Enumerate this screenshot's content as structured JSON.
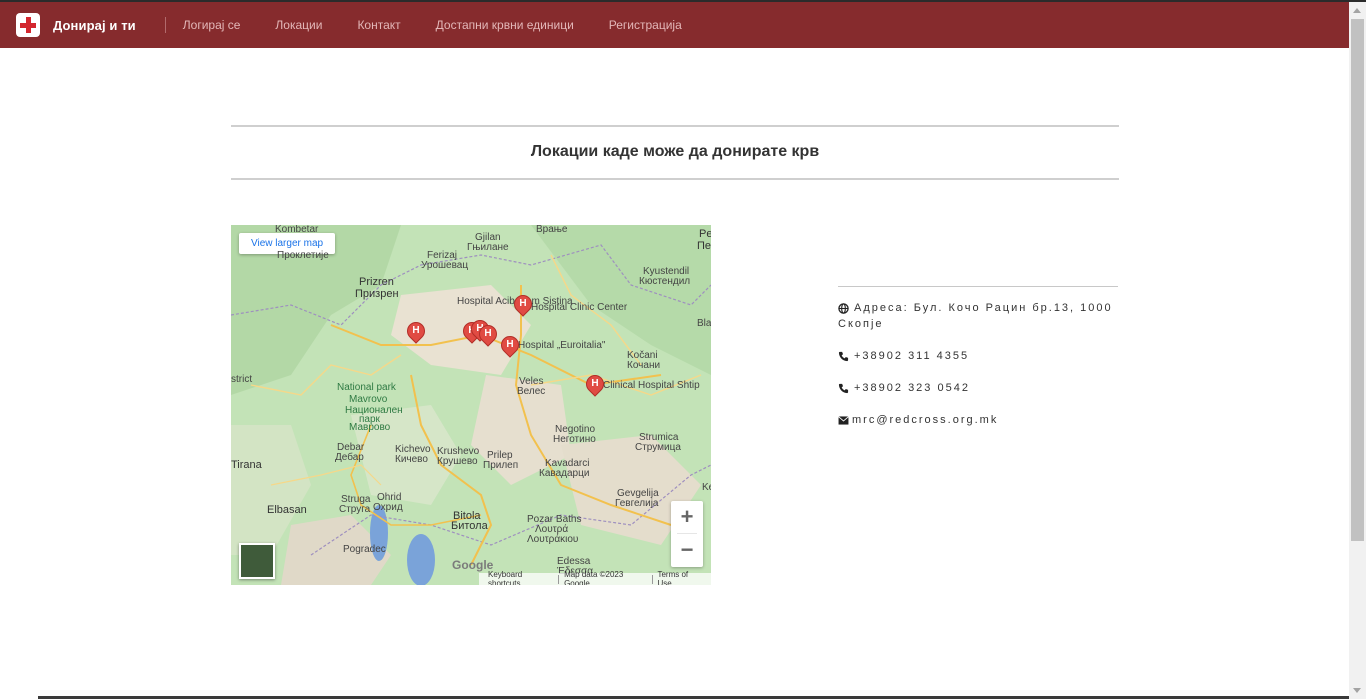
{
  "nav": {
    "brand": "Донирај и ти",
    "links": [
      "Логирај се",
      "Локации",
      "Контакт",
      "Достапни крвни единици",
      "Регистрација"
    ]
  },
  "main": {
    "title": "Локации каде може да донирате крв"
  },
  "map": {
    "view_larger": "View larger map",
    "zoom_in": "+",
    "zoom_out": "−",
    "google": "Google",
    "keyboard_shortcuts": "Keyboard shortcuts",
    "map_data": "Map data ©2023 Google",
    "terms": "Terms of Use",
    "places": {
      "kombetar": "Kombetar",
      "vranje": "Врање",
      "pe": "Pe",
      "pe2": "Пе",
      "proklet": "Проклетије",
      "ferizaj": "Ferizaj",
      "urosevac": "Урошевац",
      "gjilan": "Gjilan",
      "gnjilane": "Гњилане",
      "kyustendil": "Kyustendil",
      "kyustendil2": "Кюстендил",
      "prizren": "Prizren",
      "prizren2": "Призрен",
      "hospital_acibadem": "Hospital Acibadem Sistina",
      "hospital_clinic": "Hospital Clinic Center",
      "hospital_euroitalia": "Hospital „Euroitalia\"",
      "clinical_shtip": "Clinical Hospital Shtip",
      "kocani": "Kočani",
      "kocani2": "Кочани",
      "bla": "Bla",
      "strict": "strict",
      "national_park": "National park",
      "mavrovo": "Mavrovo",
      "nac_park": "Национален",
      "park": "парк",
      "mavrovo2": "Маврово",
      "veles": "Veles",
      "veles2": "Велес",
      "negotino": "Negotino",
      "negotino2": "Неготино",
      "strumica": "Strumica",
      "strumica2": "Струмица",
      "debar": "Debar",
      "debar2": "Дебар",
      "kichevo": "Kichevo",
      "kichevo2": "Кичево",
      "krushevo": "Krushevo",
      "krushevo2": "Крушево",
      "prilep": "Prilep",
      "prilep2": "Прилеп",
      "kavadarci": "Kavadarci",
      "kavadarci2": "Кавадарци",
      "tirana": "Tirana",
      "struga": "Struga",
      "struga2": "Струга",
      "ohrid": "Ohrid",
      "ohrid2": "Охрид",
      "gevgelija": "Gevgelija",
      "gevgelija2": "Гевгелија",
      "elbasan": "Elbasan",
      "bitola": "Bitola",
      "bitola2": "Битола",
      "pozar": "Pozar Baths",
      "pozar2": "Λουτρά",
      "pozar3": "Λουτράκιου",
      "pogradec": "Pogradec",
      "edessa": "Edessa",
      "edessa2": "Έδεσσα",
      "ke": "Ke"
    }
  },
  "contact": {
    "address": "Адреса: Бул. Кочо Рацин бр.13, 1000 Скопје",
    "phone1": "+38902 311 4355",
    "phone2": "+38902 323 0542",
    "email": "mrc@redcross.org.mk"
  },
  "colors": {
    "navbar": "#862b2d",
    "accent_red": "#d3262e",
    "pin_red": "#e04b43"
  },
  "icons": [
    "cross-logo-icon",
    "globe-icon",
    "phone-icon",
    "envelope-icon",
    "hospital-pin-icon"
  ]
}
